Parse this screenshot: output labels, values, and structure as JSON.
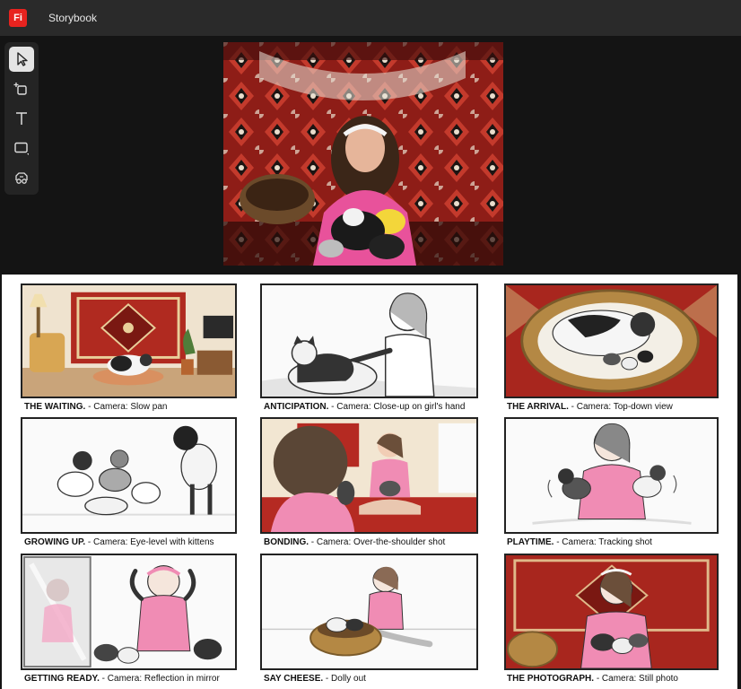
{
  "app": {
    "logo_text": "Fi",
    "title": "Storybook"
  },
  "toolbar": {
    "tools": [
      {
        "name": "select",
        "icon": "cursor-icon",
        "active": true
      },
      {
        "name": "add-frame",
        "icon": "frame-add-icon",
        "active": false
      },
      {
        "name": "text",
        "icon": "text-icon",
        "active": false
      },
      {
        "name": "shape",
        "icon": "rectangle-icon",
        "active": false
      },
      {
        "name": "generate",
        "icon": "image-generate-icon",
        "active": false
      }
    ]
  },
  "storyboard": {
    "panels": [
      {
        "title": "THE WAITING.",
        "camera": " - Camera: Slow pan"
      },
      {
        "title": "ANTICIPATION.",
        "camera": " - Camera: Close-up on girl's hand"
      },
      {
        "title": "THE ARRIVAL.",
        "camera": " - Camera: Top-down view"
      },
      {
        "title": "GROWING UP.",
        "camera": " - Camera: Eye-level with kittens"
      },
      {
        "title": "BONDING.",
        "camera": " - Camera: Over-the-shoulder shot"
      },
      {
        "title": "PLAYTIME.",
        "camera": " - Camera: Tracking shot"
      },
      {
        "title": "GETTING READY.",
        "camera": " - Camera: Reflection in mirror"
      },
      {
        "title": "SAY CHEESE.",
        "camera": " - Dolly out"
      },
      {
        "title": "THE PHOTOGRAPH.",
        "camera": " - Camera: Still photo"
      }
    ]
  },
  "colors": {
    "rug_red": "#a8261e",
    "shirt_pink": "#f08cb4",
    "accent": "#e8231f"
  }
}
